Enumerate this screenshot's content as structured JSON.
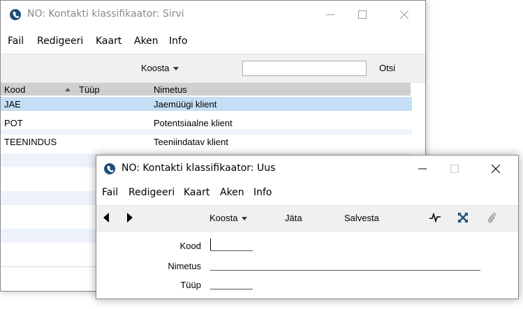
{
  "window1": {
    "title": "NO: Kontakti klassifikaator: Sirvi",
    "menu": [
      "Fail",
      "Redigeeri",
      "Kaart",
      "Aken",
      "Info"
    ],
    "toolbar": {
      "koosta_label": "Koosta",
      "search_value": "",
      "otsi_label": "Otsi"
    },
    "columns": {
      "kood": "Kood",
      "tuup": "Tüüp",
      "nimetus": "Nimetus"
    },
    "rows": [
      {
        "kood": "JAE",
        "tuup": "",
        "nimetus": "Jaemüügi klient"
      },
      {
        "kood": "POT",
        "tuup": "",
        "nimetus": "Potentsiaalne klient"
      },
      {
        "kood": "TEENINDUS",
        "tuup": "",
        "nimetus": "Teeniindatav klient"
      }
    ],
    "selected_row": 0
  },
  "window2": {
    "title": "NO: Kontakti klassifikaator: Uus",
    "menu": [
      "Fail",
      "Redigeeri",
      "Kaart",
      "Aken",
      "Info"
    ],
    "toolbar": {
      "koosta_label": "Koosta",
      "jata_label": "Jäta",
      "salvesta_label": "Salvesta"
    },
    "form": {
      "kood_label": "Kood",
      "kood_value": "",
      "nimetus_label": "Nimetus",
      "nimetus_value": "",
      "tuup_label": "Tüüp",
      "tuup_value": ""
    }
  },
  "colors": {
    "selected_row": "#c5def5",
    "alt_row": "#eef3fb",
    "header": "#cfcfcf",
    "icon_blue": "#1f4e79"
  },
  "icons": [
    "app-icon",
    "minimize-icon",
    "maximize-icon",
    "close-icon",
    "arrow-left-icon",
    "arrow-right-icon",
    "activity-icon",
    "expand-icon",
    "attachment-icon",
    "sort-ascending-icon"
  ]
}
